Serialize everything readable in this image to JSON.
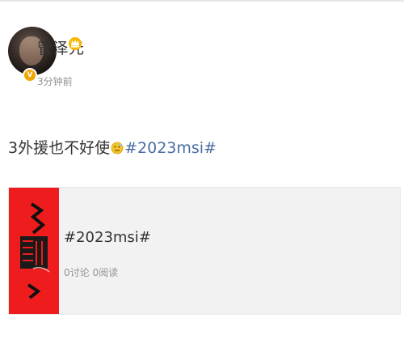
{
  "post": {
    "author": {
      "name": "管泽元",
      "verified_badge": "V"
    },
    "time": "3分钟前",
    "text": {
      "before_emoji": "3外援也不好使",
      "emoji_icon": "face-emoji-icon",
      "topic": "#2023msi#"
    },
    "topic_card": {
      "title": "#2023msi#",
      "stats": "0讨论 0阅读",
      "cover_color": "#ee1c1c"
    }
  }
}
